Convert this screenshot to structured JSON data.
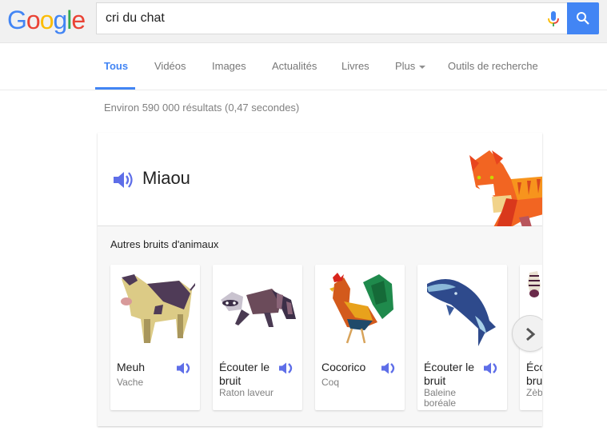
{
  "header": {
    "logo_letters": [
      {
        "char": "G",
        "color": "#4285f4"
      },
      {
        "char": "o",
        "color": "#ea4335"
      },
      {
        "char": "o",
        "color": "#fbbc05"
      },
      {
        "char": "g",
        "color": "#4285f4"
      },
      {
        "char": "l",
        "color": "#34a853"
      },
      {
        "char": "e",
        "color": "#ea4335"
      }
    ],
    "search_value": "cri du chat",
    "mic_icon": "microphone-icon",
    "search_icon": "magnifier-icon"
  },
  "tabs": [
    {
      "label": "Tous",
      "active": true
    },
    {
      "label": "Vidéos"
    },
    {
      "label": "Images"
    },
    {
      "label": "Actualités"
    },
    {
      "label": "Livres"
    },
    {
      "label": "Plus"
    },
    {
      "label": "Outils de recherche"
    }
  ],
  "result_stats": "Environ 590 000 résultats (0,47 secondes)",
  "answer_card": {
    "sound_title": "Miaou",
    "image": "cat",
    "other_label": "Autres bruits d'animaux",
    "animals": [
      {
        "sound": "Meuh",
        "name": "Vache",
        "image": "cow"
      },
      {
        "sound": "Écouter le bruit",
        "name": "Raton laveur",
        "image": "raccoon"
      },
      {
        "sound": "Cocorico",
        "name": "Coq",
        "image": "rooster"
      },
      {
        "sound": "Écouter le bruit",
        "name": "Baleine boréale",
        "image": "whale"
      },
      {
        "sound": "Écouter le bruit",
        "name": "Zèbre",
        "image": "zebra"
      }
    ],
    "next_icon": "chevron-right-icon"
  },
  "colors": {
    "accent": "#4285f4",
    "speaker": "#5e6ee8"
  }
}
